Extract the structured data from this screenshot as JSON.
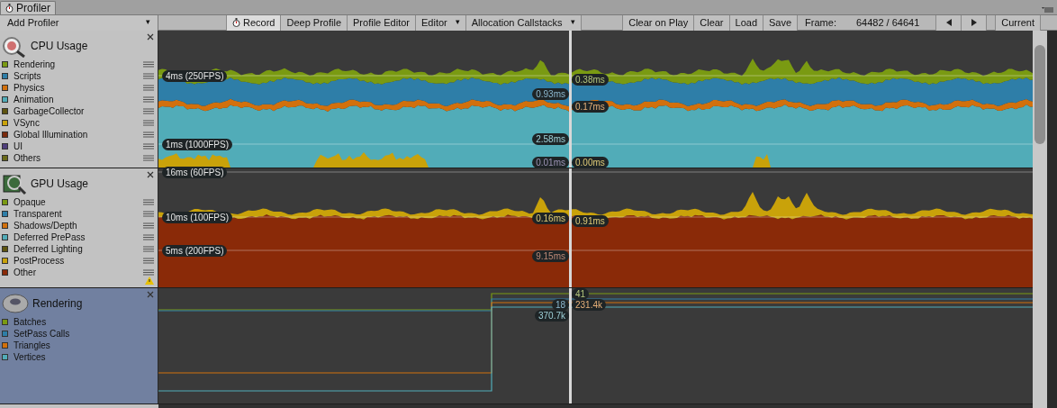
{
  "window": {
    "title": "Profiler"
  },
  "toolbar": {
    "add_profiler": "Add Profiler",
    "dropdown_glyph": "▾",
    "buttons": [
      {
        "label": "Record",
        "kind": "toggle",
        "selected": true
      },
      {
        "label": "Deep Profile",
        "kind": "toggle",
        "selected": false
      },
      {
        "label": "Profile Editor",
        "kind": "toggle",
        "selected": false
      },
      {
        "label": "Editor",
        "kind": "dropdown",
        "selected": false
      },
      {
        "label": "Allocation Callstacks",
        "kind": "dropdown",
        "selected": false
      }
    ],
    "right_buttons": [
      "Clear on Play",
      "Clear",
      "Load",
      "Save"
    ],
    "frame_label": "Frame:",
    "frame_value": "64482 / 64641",
    "current": "Current"
  },
  "modules": [
    {
      "title": "CPU Usage",
      "kind": "cpu",
      "selected": false,
      "series": [
        {
          "name": "Rendering",
          "color": "#7a9a12"
        },
        {
          "name": "Scripts",
          "color": "#2e7ea8"
        },
        {
          "name": "Physics",
          "color": "#d2700c"
        },
        {
          "name": "Animation",
          "color": "#51acb8"
        },
        {
          "name": "GarbageCollector",
          "color": "#5e5410"
        },
        {
          "name": "VSync",
          "color": "#c9a20a"
        },
        {
          "name": "Global Illumination",
          "color": "#7a2a0c"
        },
        {
          "name": "UI",
          "color": "#4f3e7c"
        },
        {
          "name": "Others",
          "color": "#6a6a1a"
        }
      ],
      "grid_labels": [
        "4ms (250FPS)",
        "1ms (1000FPS)"
      ],
      "value_labels": [
        "0.38ms",
        "0.93ms",
        "0.17ms",
        "2.58ms",
        "0.01ms",
        "0.00ms"
      ]
    },
    {
      "title": "GPU Usage",
      "kind": "gpu",
      "selected": false,
      "warning": true,
      "series": [
        {
          "name": "Opaque",
          "color": "#7a9a12"
        },
        {
          "name": "Transparent",
          "color": "#2e7ea8"
        },
        {
          "name": "Shadows/Depth",
          "color": "#d2700c"
        },
        {
          "name": "Deferred PrePass",
          "color": "#51acb8"
        },
        {
          "name": "Deferred Lighting",
          "color": "#5e5410"
        },
        {
          "name": "PostProcess",
          "color": "#c9a20a"
        },
        {
          "name": "Other",
          "color": "#8a2a08"
        }
      ],
      "grid_labels": [
        "16ms (60FPS)",
        "10ms (100FPS)",
        "5ms (200FPS)"
      ],
      "value_labels": [
        "0.16ms",
        "0.91ms",
        "9.15ms"
      ]
    },
    {
      "title": "Rendering",
      "kind": "counters",
      "selected": true,
      "series": [
        {
          "name": "Batches",
          "color": "#7a9a12"
        },
        {
          "name": "SetPass Calls",
          "color": "#2e7ea8"
        },
        {
          "name": "Triangles",
          "color": "#d2700c"
        },
        {
          "name": "Vertices",
          "color": "#51acb8"
        }
      ],
      "value_labels": [
        "41",
        "18",
        "231.4k",
        "370.7k"
      ]
    }
  ]
}
